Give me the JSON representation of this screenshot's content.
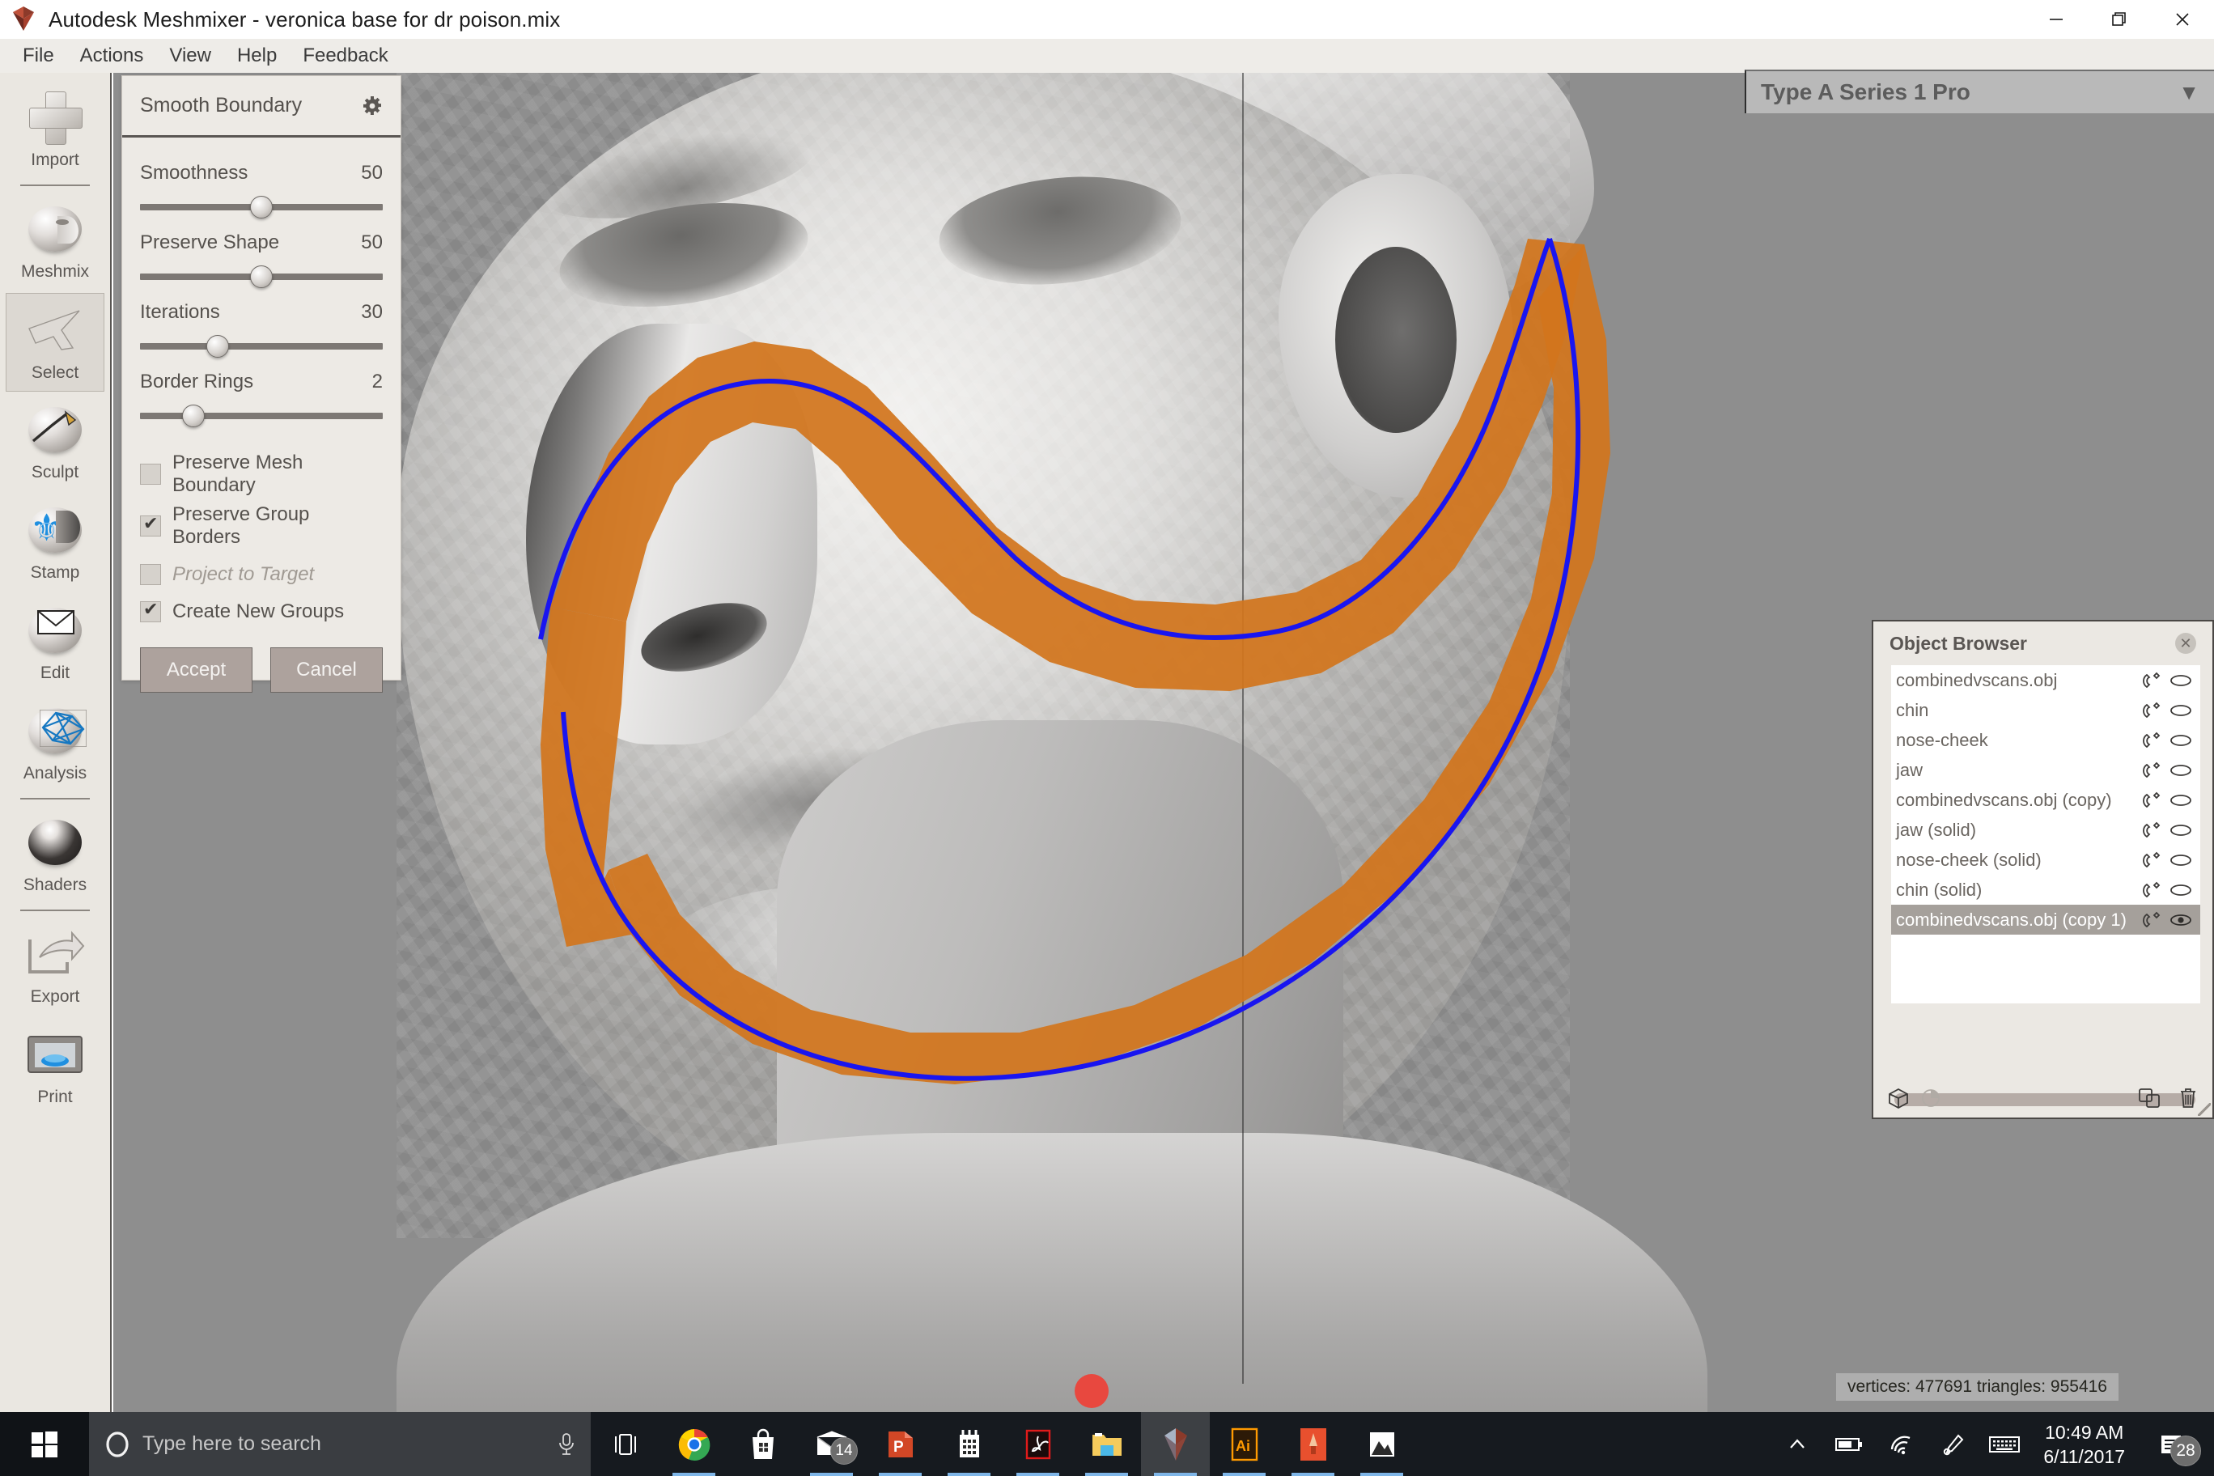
{
  "window": {
    "title": "Autodesk Meshmixer - veronica base for dr poison.mix",
    "app_icon": "meshmixer-logo-icon",
    "controls": {
      "minimize": "—",
      "maximize": "❐",
      "close": "✕"
    }
  },
  "menubar": {
    "items": [
      "File",
      "Actions",
      "View",
      "Help",
      "Feedback"
    ]
  },
  "toolrail": {
    "items": [
      {
        "label": "Import",
        "icon": "plus-icon",
        "selected": false
      },
      {
        "label": "Meshmix",
        "icon": "face-sphere-icon",
        "selected": false
      },
      {
        "label": "Select",
        "icon": "arrow-cursor-icon",
        "selected": true
      },
      {
        "label": "Sculpt",
        "icon": "sculpt-brush-icon",
        "selected": false
      },
      {
        "label": "Stamp",
        "icon": "stamp-fleur-icon",
        "selected": false
      },
      {
        "label": "Edit",
        "icon": "edit-envelope-icon",
        "selected": false
      },
      {
        "label": "Analysis",
        "icon": "mesh-wireframe-icon",
        "selected": false
      },
      {
        "label": "Shaders",
        "icon": "shader-sphere-icon",
        "selected": false
      },
      {
        "label": "Export",
        "icon": "export-arrow-icon",
        "selected": false
      },
      {
        "label": "Print",
        "icon": "printer-icon",
        "selected": false
      }
    ]
  },
  "panel": {
    "title": "Smooth Boundary",
    "settings_icon": "gear-icon",
    "params": [
      {
        "label": "Smoothness",
        "value": "50",
        "pct": 50
      },
      {
        "label": "Preserve Shape",
        "value": "50",
        "pct": 50
      },
      {
        "label": "Iterations",
        "value": "30",
        "pct": 32
      },
      {
        "label": "Border Rings",
        "value": "2",
        "pct": 22
      }
    ],
    "checks": [
      {
        "label": "Preserve Mesh Boundary",
        "checked": false,
        "disabled": false
      },
      {
        "label": "Preserve Group Borders",
        "checked": true,
        "disabled": false
      },
      {
        "label": "Project to Target",
        "checked": false,
        "disabled": true
      },
      {
        "label": "Create New Groups",
        "checked": true,
        "disabled": false
      }
    ],
    "accept_label": "Accept",
    "cancel_label": "Cancel"
  },
  "printer": {
    "name": "Type A Series 1 Pro",
    "caret_icon": "chevron-down-icon"
  },
  "viewport": {
    "status": "vertices: 477691 triangles: 955416",
    "selection_color": "#d2751d",
    "boundary_curve_color": "#1915f0",
    "background_color": "#8e8e8e"
  },
  "object_browser": {
    "title": "Object Browser",
    "close_icon": "close-icon",
    "rows": [
      {
        "name": "combinedvscans.obj",
        "selected": false
      },
      {
        "name": "chin",
        "selected": false
      },
      {
        "name": "nose-cheek",
        "selected": false
      },
      {
        "name": "jaw",
        "selected": false
      },
      {
        "name": "combinedvscans.obj (copy)",
        "selected": false
      },
      {
        "name": "jaw (solid)",
        "selected": false
      },
      {
        "name": "nose-cheek (solid)",
        "selected": false
      },
      {
        "name": "chin (solid)",
        "selected": false
      },
      {
        "name": "combinedvscans.obj (copy 1)",
        "selected": true
      }
    ],
    "row_icons": {
      "link": "magnet-icon",
      "visibility": "eye-icon"
    },
    "footer_icons": [
      "cube-icon",
      "pie-icon",
      "duplicate-icon",
      "trash-icon"
    ]
  },
  "taskbar": {
    "start_icon": "windows-start-icon",
    "search_placeholder": "Type here to search",
    "search_icon": "cortana-circle-icon",
    "mic_icon": "microphone-icon",
    "items": [
      {
        "icon": "task-view-icon",
        "name": "task-view",
        "active": false,
        "open": false,
        "badge": ""
      },
      {
        "icon": "chrome-icon",
        "name": "google-chrome",
        "active": false,
        "open": true,
        "badge": ""
      },
      {
        "icon": "store-icon",
        "name": "microsoft-store",
        "active": false,
        "open": false,
        "badge": ""
      },
      {
        "icon": "mail-icon",
        "name": "mail",
        "active": false,
        "open": true,
        "badge": "14"
      },
      {
        "icon": "powerpoint-icon",
        "name": "powerpoint",
        "active": false,
        "open": true,
        "badge": ""
      },
      {
        "icon": "calendar-icon",
        "name": "calendar",
        "active": false,
        "open": true,
        "badge": ""
      },
      {
        "icon": "acrobat-icon",
        "name": "adobe-acrobat",
        "active": false,
        "open": true,
        "badge": ""
      },
      {
        "icon": "folder-icon",
        "name": "file-explorer",
        "active": false,
        "open": true,
        "badge": ""
      },
      {
        "icon": "meshmixer-icon",
        "name": "meshmixer",
        "active": true,
        "open": true,
        "badge": ""
      },
      {
        "icon": "illustrator-icon",
        "name": "adobe-illustrator",
        "active": false,
        "open": true,
        "badge": ""
      },
      {
        "icon": "sketch-pencil-icon",
        "name": "paint-3d",
        "active": false,
        "open": true,
        "badge": ""
      },
      {
        "icon": "photos-icon",
        "name": "photos",
        "active": false,
        "open": true,
        "badge": ""
      }
    ],
    "tray": [
      {
        "icon": "chevron-up-icon",
        "name": "show-hidden-icons"
      },
      {
        "icon": "battery-icon",
        "name": "battery"
      },
      {
        "icon": "wifi-icon",
        "name": "network"
      },
      {
        "icon": "pen-icon",
        "name": "windows-ink"
      },
      {
        "icon": "keyboard-icon",
        "name": "touch-keyboard"
      }
    ],
    "clock": {
      "time": "10:49 AM",
      "date": "6/11/2017"
    },
    "notifications": {
      "icon": "action-center-icon",
      "count": "28"
    }
  }
}
